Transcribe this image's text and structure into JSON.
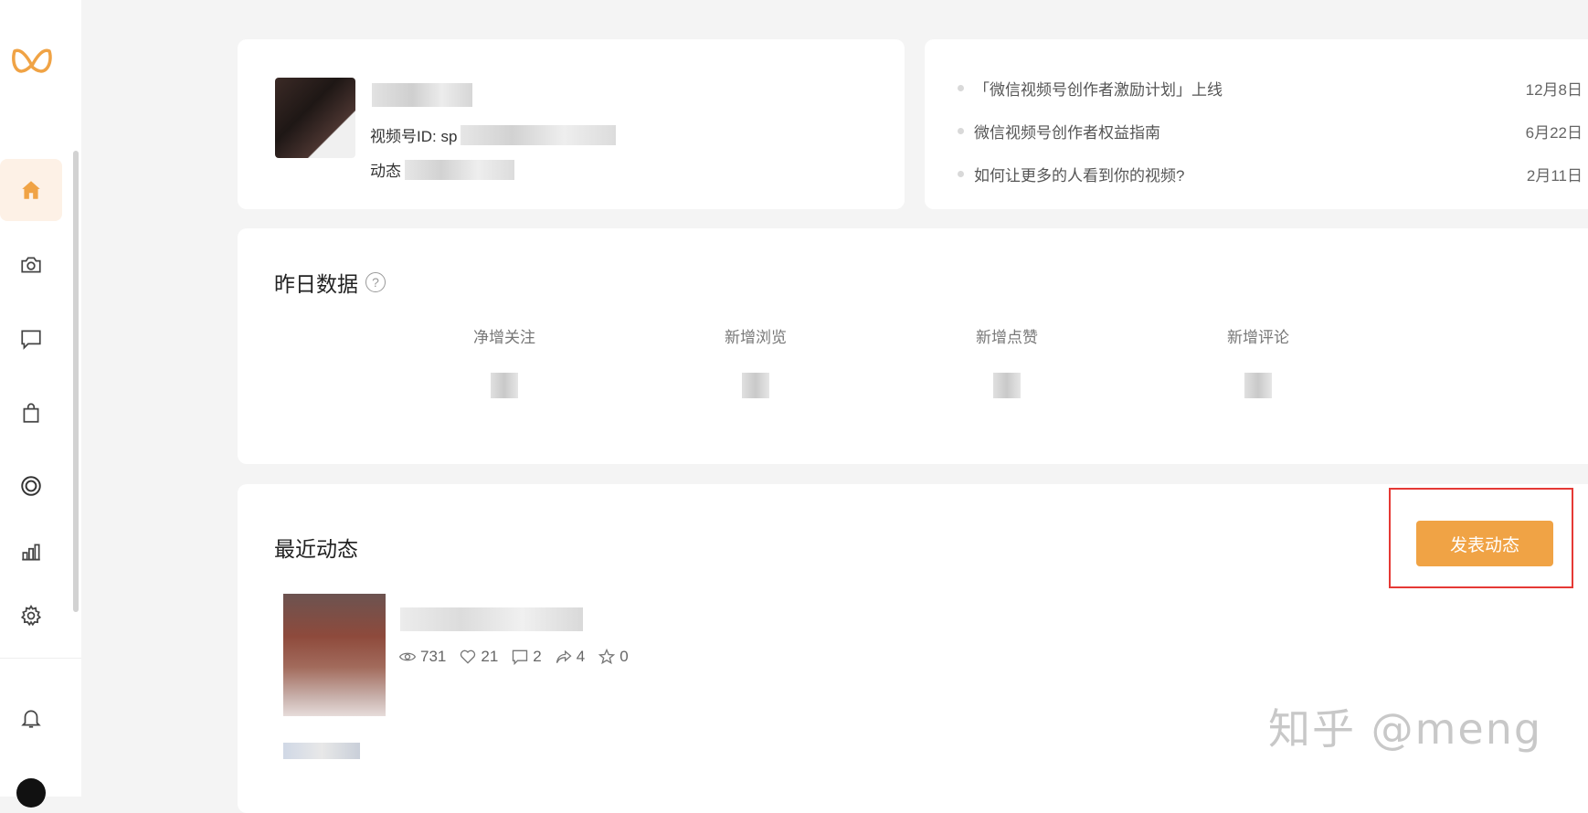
{
  "sidebar": {
    "logo_icon": "channels-logo-icon",
    "items": [
      {
        "id": "home",
        "icon": "home-icon",
        "active": true
      },
      {
        "id": "camera",
        "icon": "camera-icon"
      },
      {
        "id": "comments",
        "icon": "comment-icon"
      },
      {
        "id": "shop",
        "icon": "shopping-bag-icon"
      },
      {
        "id": "live",
        "icon": "target-icon"
      },
      {
        "id": "analytics",
        "icon": "bar-chart-icon"
      },
      {
        "id": "settings",
        "icon": "gear-icon"
      }
    ],
    "bottom": [
      {
        "id": "notifications",
        "icon": "bell-icon"
      }
    ],
    "accent_color": "#f0a345"
  },
  "profile": {
    "id_label": "视频号ID: sp",
    "moments_label": "动态"
  },
  "news": {
    "items": [
      {
        "title": "「微信视频号创作者激励计划」上线",
        "date": "12月8日"
      },
      {
        "title": "微信视频号创作者权益指南",
        "date": "6月22日"
      },
      {
        "title": "如何让更多的人看到你的视频?",
        "date": "2月11日"
      }
    ]
  },
  "yesterday": {
    "title": "昨日数据",
    "help_glyph": "?",
    "metrics": [
      {
        "label": "净增关注"
      },
      {
        "label": "新增浏览"
      },
      {
        "label": "新增点赞"
      },
      {
        "label": "新增评论"
      }
    ]
  },
  "recent": {
    "title": "最近动态",
    "publish_button": "发表动态",
    "post": {
      "views": "731",
      "likes": "21",
      "comments": "2",
      "shares": "4",
      "favorites": "0"
    }
  },
  "watermark": "知乎 @meng"
}
